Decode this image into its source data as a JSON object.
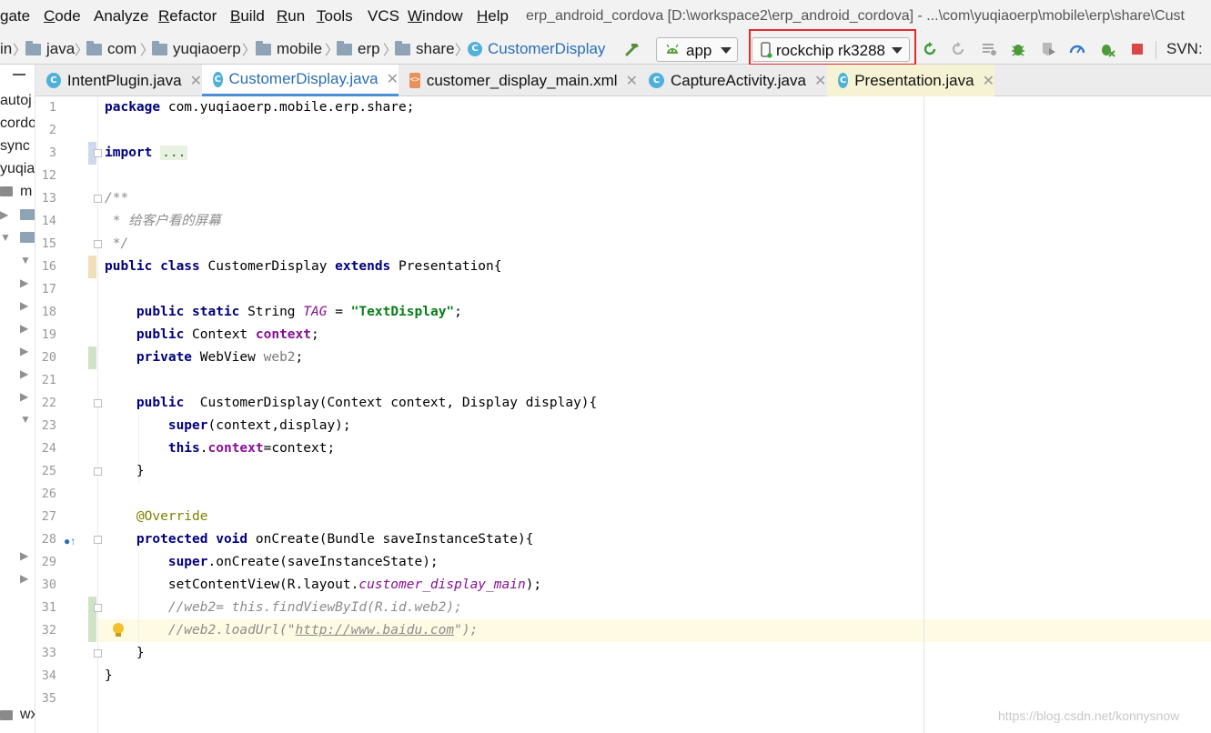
{
  "menubar": {
    "items": [
      {
        "label": "gate",
        "underline": ""
      },
      {
        "label": "Code",
        "underline": "C"
      },
      {
        "label": "Analyze",
        "underline": ""
      },
      {
        "label": "Refactor",
        "underline": "R"
      },
      {
        "label": "Build",
        "underline": "B"
      },
      {
        "label": "Run",
        "underline": "R"
      },
      {
        "label": "Tools",
        "underline": "T"
      },
      {
        "label": "VCS",
        "underline": ""
      },
      {
        "label": "Window",
        "underline": "W"
      },
      {
        "label": "Help",
        "underline": "H"
      }
    ],
    "window_title": "erp_android_cordova [D:\\workspace2\\erp_android_cordova] - ...\\com\\yuqiaoerp\\mobile\\erp\\share\\Cust"
  },
  "breadcrumb": {
    "items": [
      "in",
      "java",
      "com",
      "yuqiaoerp",
      "mobile",
      "erp",
      "share",
      "CustomerDisplay"
    ]
  },
  "toolbar": {
    "run_config": "app",
    "device": "rockchip rk3288",
    "svn_label": "SVN:"
  },
  "project_strip": {
    "items": [
      "autoj",
      "cordo",
      "sync",
      "yuqia",
      "m",
      "wx"
    ]
  },
  "tabs": [
    {
      "label": "IntentPlugin.java",
      "icon": "class-icon",
      "active": false
    },
    {
      "label": "CustomerDisplay.java",
      "icon": "class-icon",
      "active": true
    },
    {
      "label": "customer_display_main.xml",
      "icon": "xml-icon",
      "active": false
    },
    {
      "label": "CaptureActivity.java",
      "icon": "class-icon",
      "active": false
    },
    {
      "label": "Presentation.java",
      "icon": "class-icon",
      "active": false
    }
  ],
  "editor": {
    "line_numbers": [
      "1",
      "2",
      "3",
      "12",
      "13",
      "14",
      "15",
      "16",
      "17",
      "18",
      "19",
      "20",
      "21",
      "22",
      "23",
      "24",
      "25",
      "26",
      "27",
      "28",
      "29",
      "30",
      "31",
      "32",
      "33",
      "34",
      "35"
    ],
    "lines": [
      [
        {
          "t": "package",
          "c": "kw"
        },
        {
          "t": " com.yuqiaoerp.mobile.erp.share;",
          "c": ""
        }
      ],
      [],
      [
        {
          "t": "import",
          "c": "kw"
        },
        {
          "t": " ",
          "c": ""
        },
        {
          "t": "...",
          "c": "collapsed"
        }
      ],
      [],
      [
        {
          "t": "/**",
          "c": "cmt"
        }
      ],
      [
        {
          "t": " * 给客户看的屏幕",
          "c": "cmt"
        }
      ],
      [
        {
          "t": " */",
          "c": "cmt"
        }
      ],
      [
        {
          "t": "public class",
          "c": "kw"
        },
        {
          "t": " CustomerDisplay ",
          "c": ""
        },
        {
          "t": "extends",
          "c": "kw"
        },
        {
          "t": " Presentation{",
          "c": ""
        }
      ],
      [],
      [
        {
          "t": "    ",
          "c": ""
        },
        {
          "t": "public static",
          "c": "kw"
        },
        {
          "t": " String ",
          "c": ""
        },
        {
          "t": "TAG",
          "c": "static-fld"
        },
        {
          "t": " = ",
          "c": ""
        },
        {
          "t": "\"TextDisplay\"",
          "c": "str"
        },
        {
          "t": ";",
          "c": ""
        }
      ],
      [
        {
          "t": "    ",
          "c": ""
        },
        {
          "t": "public",
          "c": "kw"
        },
        {
          "t": " Context ",
          "c": ""
        },
        {
          "t": "context",
          "c": "fld"
        },
        {
          "t": ";",
          "c": ""
        }
      ],
      [
        {
          "t": "    ",
          "c": ""
        },
        {
          "t": "private",
          "c": "kw"
        },
        {
          "t": " WebView ",
          "c": ""
        },
        {
          "t": "web2",
          "c": "fld-unused"
        },
        {
          "t": ";",
          "c": ""
        }
      ],
      [],
      [
        {
          "t": "    ",
          "c": ""
        },
        {
          "t": "public",
          "c": "kw"
        },
        {
          "t": "  CustomerDisplay(Context context, Display display){",
          "c": ""
        }
      ],
      [
        {
          "t": "        ",
          "c": ""
        },
        {
          "t": "super",
          "c": "kw"
        },
        {
          "t": "(context,display);",
          "c": ""
        }
      ],
      [
        {
          "t": "        ",
          "c": ""
        },
        {
          "t": "this",
          "c": "kw"
        },
        {
          "t": ".",
          "c": ""
        },
        {
          "t": "context",
          "c": "fld"
        },
        {
          "t": "=context;",
          "c": ""
        }
      ],
      [
        {
          "t": "    }",
          "c": ""
        }
      ],
      [],
      [
        {
          "t": "    ",
          "c": ""
        },
        {
          "t": "@Override",
          "c": "ann"
        }
      ],
      [
        {
          "t": "    ",
          "c": ""
        },
        {
          "t": "protected void",
          "c": "kw"
        },
        {
          "t": " onCreate(Bundle saveInstanceState){",
          "c": ""
        }
      ],
      [
        {
          "t": "        ",
          "c": ""
        },
        {
          "t": "super",
          "c": "kw"
        },
        {
          "t": ".onCreate(saveInstanceState);",
          "c": ""
        }
      ],
      [
        {
          "t": "        setContentView(R.layout.",
          "c": ""
        },
        {
          "t": "customer_display_main",
          "c": "static-fld"
        },
        {
          "t": ");",
          "c": ""
        }
      ],
      [
        {
          "t": "        ",
          "c": ""
        },
        {
          "t": "//web2= this.findViewById(R.id.web2);",
          "c": "cmt"
        }
      ],
      [
        {
          "t": "        ",
          "c": ""
        },
        {
          "t": "//web2.loadUrl(\"",
          "c": "cmt"
        },
        {
          "t": "http://www.baidu.com",
          "c": "link"
        },
        {
          "t": "\");",
          "c": "cmt"
        }
      ],
      [
        {
          "t": "    }",
          "c": ""
        }
      ],
      [
        {
          "t": "}",
          "c": ""
        }
      ],
      []
    ]
  },
  "watermark": "https://blog.csdn.net/konnysnow",
  "colors": {
    "keyword": "#000080",
    "string": "#067d17",
    "field": "#871094",
    "comment": "#8c8c8c",
    "annotation": "#808000",
    "device_highlight": "#e32b2b"
  }
}
